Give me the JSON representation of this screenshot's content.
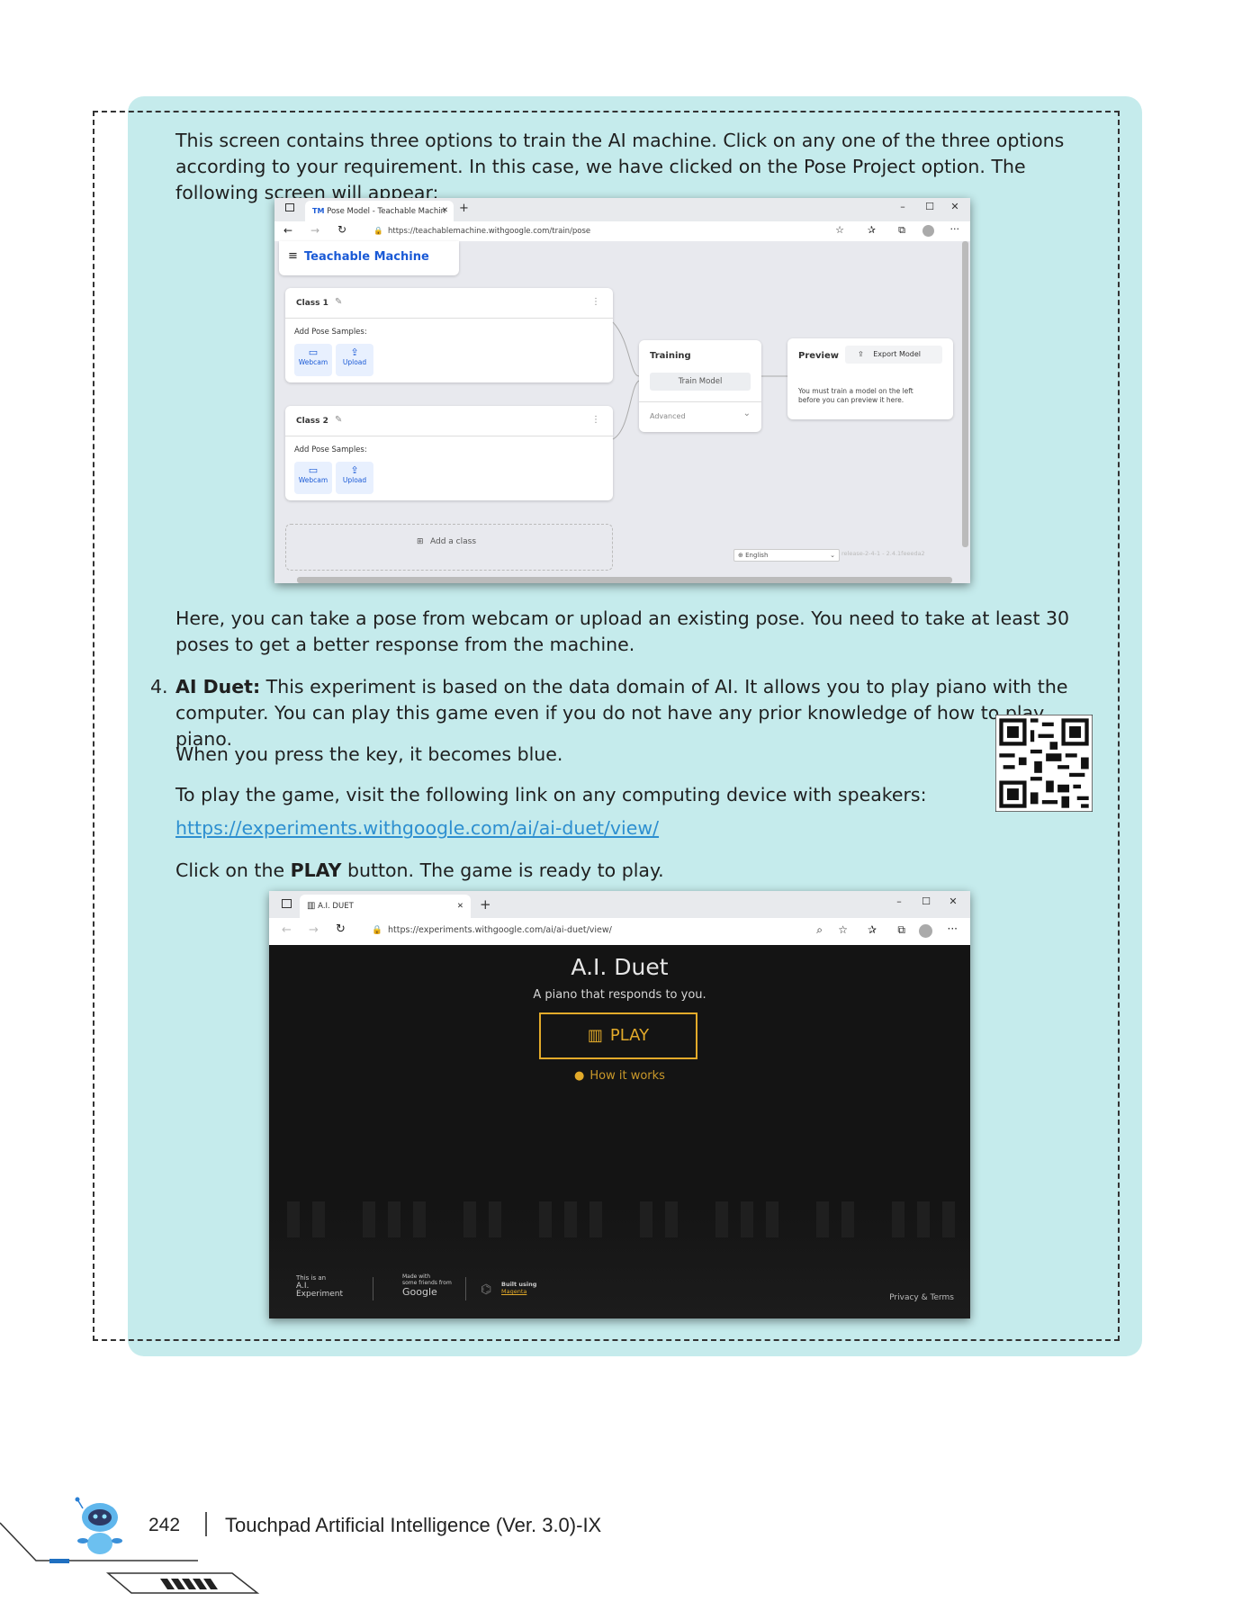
{
  "intro_text": "This screen contains three options to train the AI machine. Click on any one of the three options according to your requirement. In this case, we have clicked on the Pose Project option. The following screen will appear:",
  "tm_window": {
    "tab_title": "Pose Model - Teachable Machin",
    "url": "https://teachablemachine.withgoogle.com/train/pose",
    "app_title": "Teachable Machine",
    "class1": "Class 1",
    "class2": "Class 2",
    "add_samples": "Add Pose Samples:",
    "webcam": "Webcam",
    "upload": "Upload",
    "training": "Training",
    "train_model": "Train Model",
    "advanced": "Advanced",
    "preview": "Preview",
    "export_model": "Export Model",
    "preview_note": "You must train a model on the left before you can preview it here.",
    "add_class": "Add a class",
    "language": "English",
    "release": "release-2-4-1 - 2.4.1feeeda2"
  },
  "para_webcam": "Here, you can take a pose from webcam or upload an existing pose. You need to take at least 30 poses to get a better response from the machine.",
  "item4": {
    "number": "4.",
    "bold": "AI Duet:",
    "text": " This experiment is based on the data domain of AI. It allows you to play piano with the computer. You can play this game even if you do not have any prior knowledge of how to play piano."
  },
  "para_blue": "When you press the key, it becomes blue.",
  "para_visit": "To play the game, visit the following link on any computing device with speakers:",
  "link": "https://experiments.withgoogle.com/ai/ai-duet/view/",
  "click_play": {
    "pre": "Click on the ",
    "bold": "PLAY",
    "post": " button. The game is ready to play."
  },
  "duet_window": {
    "tab_title": "A.I. DUET",
    "url": "https://experiments.withgoogle.com/ai/ai-duet/view/",
    "title": "A.I. Duet",
    "subtitle": "A piano that responds to you.",
    "play": "PLAY",
    "how": "How it works",
    "footer_this": "This is an",
    "footer_ai": "A.I.",
    "footer_exp": "Experiment",
    "footer_made": "Made with",
    "footer_friends": "some friends from",
    "footer_google": "Google",
    "footer_built": "Built using",
    "footer_magenta": "Magenta",
    "footer_privacy": "Privacy & Terms"
  },
  "footer": {
    "page_number": "242",
    "book_title": "Touchpad Artificial Intelligence (Ver. 3.0)-IX"
  }
}
